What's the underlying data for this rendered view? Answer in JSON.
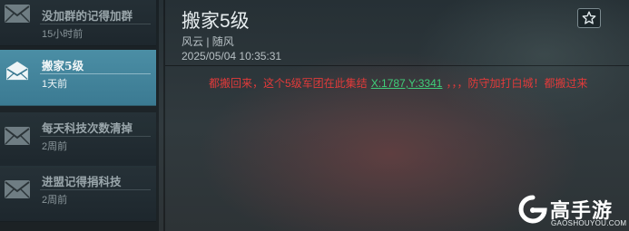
{
  "mail_list": [
    {
      "title": "没加群的记得加群",
      "time": "15小时前",
      "active": false
    },
    {
      "title": "搬家5级",
      "time": "1天前",
      "active": true
    },
    {
      "title": "每天科技次数清掉",
      "time": "2周前",
      "active": false
    },
    {
      "title": "进盟记得捐科技",
      "time": "2周前",
      "active": false
    }
  ],
  "message": {
    "subject": "搬家5级",
    "sender": "风云 | 随风",
    "date": "2025/05/04  10:35:31",
    "body_before": "都搬回来，这个5级军团在此集结",
    "coord_link": "X:1787,Y:3341",
    "body_after": "，，，防守加打白城！都搬过来"
  },
  "icons": {
    "mail": "envelope-icon",
    "favorite": "star-icon"
  },
  "colors": {
    "active_item": "#3f84a0",
    "body_text": "#e23a3a",
    "coord_link": "#3fcf7a"
  },
  "watermark": {
    "brand": "高手游",
    "url": "GAOSHOUYOU.COM"
  }
}
